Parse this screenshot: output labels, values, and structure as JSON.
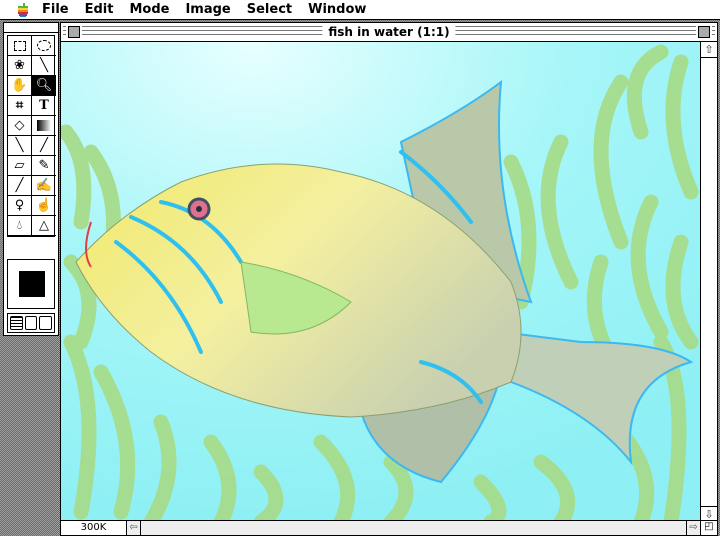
{
  "menubar": {
    "items": [
      "File",
      "Edit",
      "Mode",
      "Image",
      "Select",
      "Window"
    ]
  },
  "tools": [
    "rect-marquee",
    "ellipse-marquee",
    "lasso",
    "magic-wand",
    "hand",
    "zoom",
    "crop",
    "type",
    "paint-bucket",
    "gradient",
    "line",
    "eyedropper",
    "eraser",
    "pencil",
    "airbrush",
    "paintbrush",
    "rubber-stamp",
    "smudge",
    "blur",
    "sharpen"
  ],
  "selected_tool": "zoom",
  "colors": {
    "foreground": "#000000",
    "background": "#ffffff"
  },
  "window": {
    "title": "fish in water  (1:1)",
    "doc_size": "300K"
  },
  "icons": {
    "up": "⇧",
    "down": "⇩",
    "left": "⇦",
    "right": "⇨"
  }
}
